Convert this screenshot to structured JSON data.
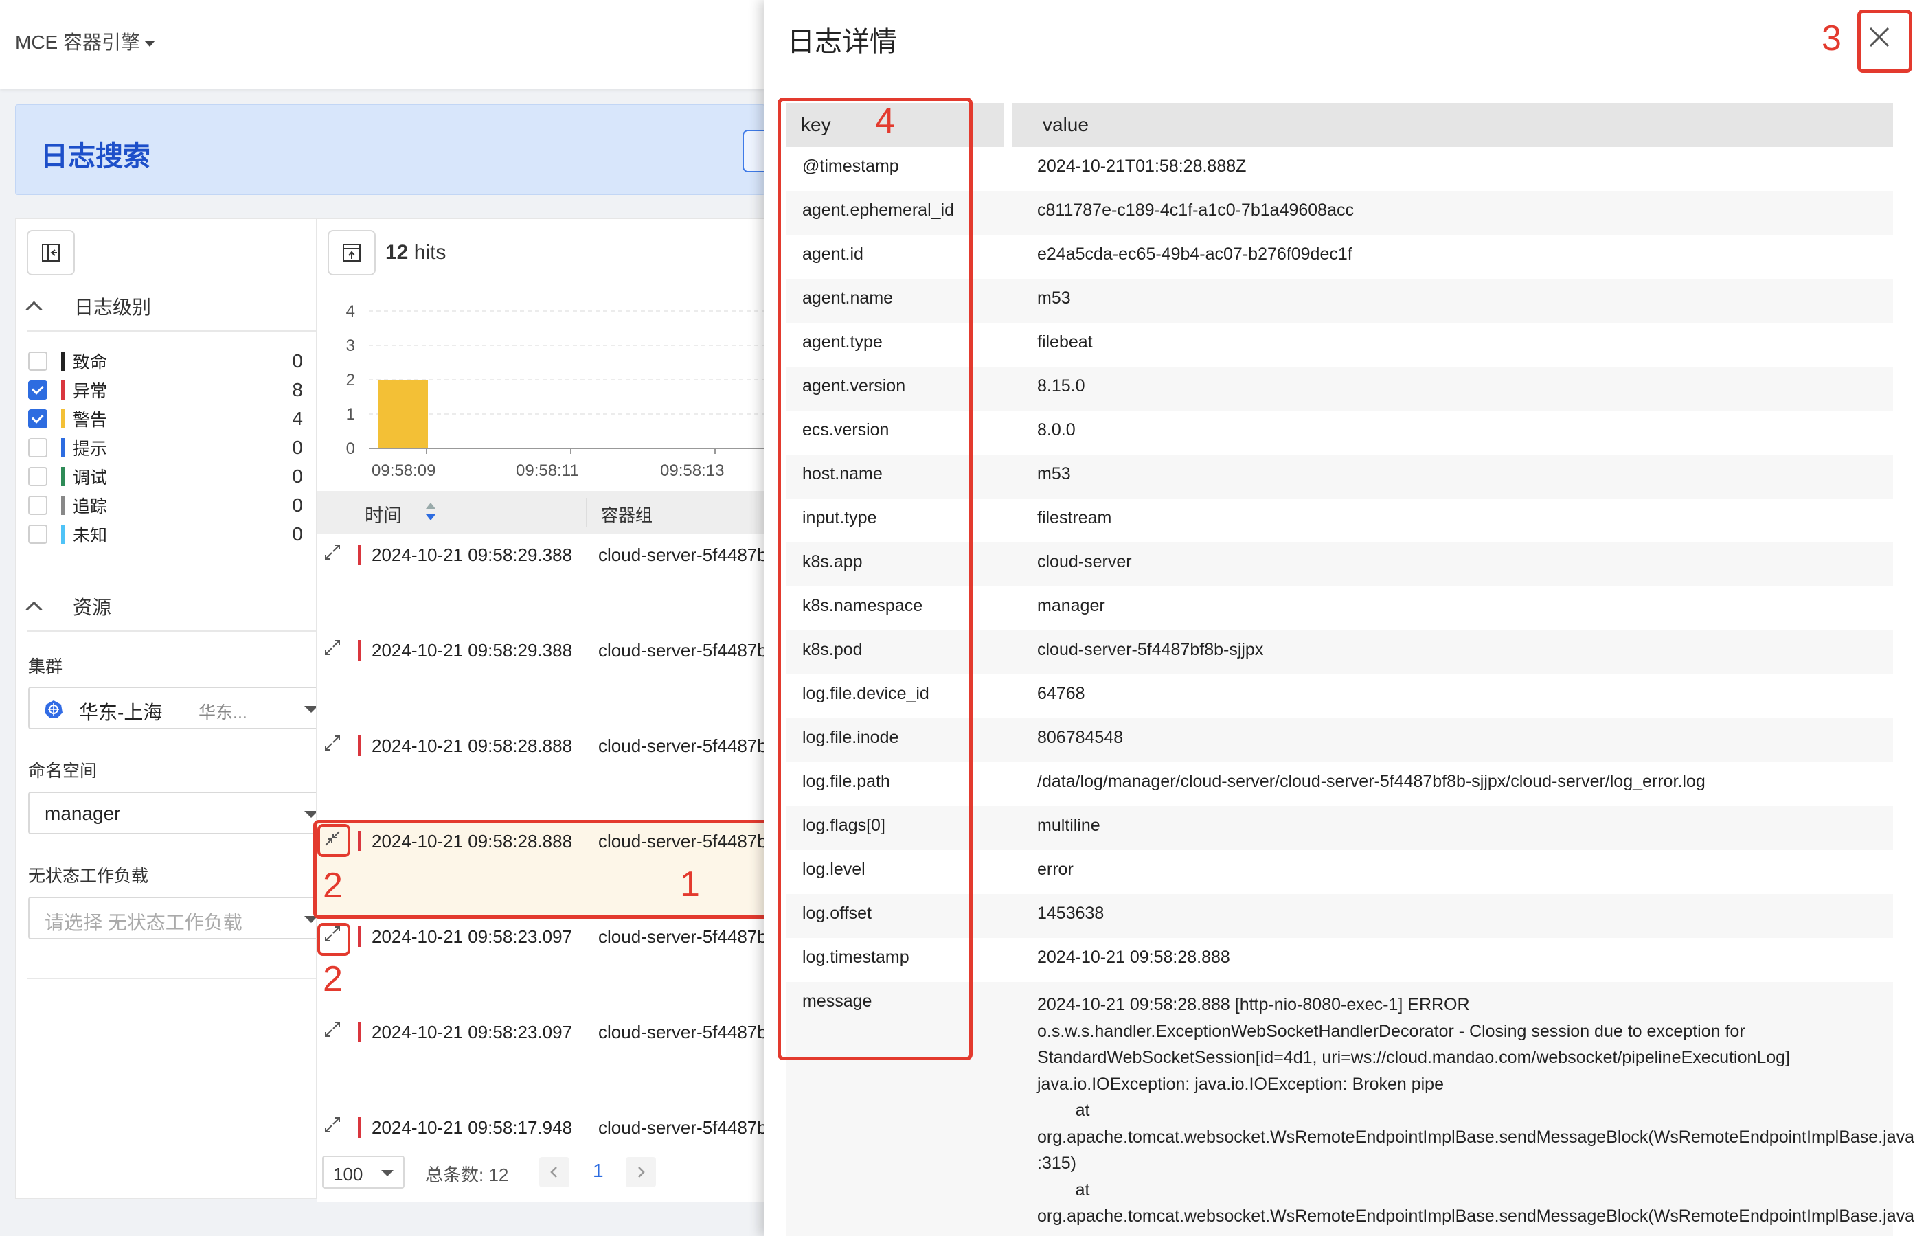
{
  "topbar": {
    "product": "MCE 容器引擎"
  },
  "banner": {
    "title": "日志搜索"
  },
  "filter": {
    "level_section": "日志级别",
    "levels": [
      {
        "label": "致命",
        "count": "0",
        "checked": false,
        "color": "#222222"
      },
      {
        "label": "异常",
        "count": "8",
        "checked": true,
        "color": "#d9363e"
      },
      {
        "label": "警告",
        "count": "4",
        "checked": true,
        "color": "#f3c036"
      },
      {
        "label": "提示",
        "count": "0",
        "checked": false,
        "color": "#2d6ce0"
      },
      {
        "label": "调试",
        "count": "0",
        "checked": false,
        "color": "#2e8b57"
      },
      {
        "label": "追踪",
        "count": "0",
        "checked": false,
        "color": "#888888"
      },
      {
        "label": "未知",
        "count": "0",
        "checked": false,
        "color": "#4fc3f7"
      }
    ],
    "resource_section": "资源",
    "cluster_label": "集群",
    "cluster_value": "华东-上海",
    "cluster_sub": "华东...",
    "namespace_label": "命名空间",
    "namespace_value": "manager",
    "workload_label": "无状态工作负载",
    "workload_placeholder": "请选择 无状态工作负载"
  },
  "main": {
    "hits_count": "12",
    "hits_label": "hits",
    "columns": [
      "时间",
      "容器组"
    ],
    "rows": [
      {
        "time": "2024-10-21 09:58:29.388",
        "group": "cloud-server-5f4487b",
        "active": false
      },
      {
        "time": "2024-10-21 09:58:29.388",
        "group": "cloud-server-5f4487b",
        "active": false
      },
      {
        "time": "2024-10-21 09:58:28.888",
        "group": "cloud-server-5f4487b",
        "active": false
      },
      {
        "time": "2024-10-21 09:58:28.888",
        "group": "cloud-server-5f4487b",
        "active": true
      },
      {
        "time": "2024-10-21 09:58:23.097",
        "group": "cloud-server-5f4487b",
        "active": false
      },
      {
        "time": "2024-10-21 09:58:23.097",
        "group": "cloud-server-5f4487b",
        "active": false
      },
      {
        "time": "2024-10-21 09:58:17.948",
        "group": "cloud-server-5f4487b",
        "active": false
      }
    ],
    "pagination": {
      "page_size": "100",
      "total_label": "总条数: 12",
      "current_page": "1"
    }
  },
  "chart_data": {
    "type": "bar",
    "categories": [
      "09:58:09",
      "09:58:11",
      "09:58:13"
    ],
    "values": [
      2,
      0,
      0
    ],
    "yticks": [
      "0",
      "1",
      "2",
      "3",
      "4"
    ],
    "ylim": [
      0,
      4
    ],
    "color": "#f3c036",
    "grid": true
  },
  "drawer": {
    "title": "日志详情",
    "columns": {
      "key": "key",
      "value": "value"
    },
    "rows": [
      {
        "key": "@timestamp",
        "value": "2024-10-21T01:58:28.888Z"
      },
      {
        "key": "agent.ephemeral_id",
        "value": "c811787e-c189-4c1f-a1c0-7b1a49608acc"
      },
      {
        "key": "agent.id",
        "value": "e24a5cda-ec65-49b4-ac07-b276f09dec1f"
      },
      {
        "key": "agent.name",
        "value": "m53"
      },
      {
        "key": "agent.type",
        "value": "filebeat"
      },
      {
        "key": "agent.version",
        "value": "8.15.0"
      },
      {
        "key": "ecs.version",
        "value": "8.0.0"
      },
      {
        "key": "host.name",
        "value": "m53"
      },
      {
        "key": "input.type",
        "value": "filestream"
      },
      {
        "key": "k8s.app",
        "value": "cloud-server"
      },
      {
        "key": "k8s.namespace",
        "value": "manager"
      },
      {
        "key": "k8s.pod",
        "value": "cloud-server-5f4487bf8b-sjjpx"
      },
      {
        "key": "log.file.device_id",
        "value": "64768"
      },
      {
        "key": "log.file.inode",
        "value": "806784548"
      },
      {
        "key": "log.file.path",
        "value": "/data/log/manager/cloud-server/cloud-server-5f4487bf8b-sjjpx/cloud-server/log_error.log"
      },
      {
        "key": "log.flags[0]",
        "value": "multiline"
      },
      {
        "key": "log.level",
        "value": "error"
      },
      {
        "key": "log.offset",
        "value": "1453638"
      },
      {
        "key": "log.timestamp",
        "value": "2024-10-21 09:58:28.888"
      }
    ],
    "message_key": "message",
    "message_value": "2024-10-21 09:58:28.888 [http-nio-8080-exec-1] ERROR\no.s.w.s.handler.ExceptionWebSocketHandlerDecorator - Closing session due to exception for\nStandardWebSocketSession[id=4d1, uri=ws://cloud.mandao.com/websocket/pipelineExecutionLog]\njava.io.IOException: java.io.IOException: Broken pipe\n        at\norg.apache.tomcat.websocket.WsRemoteEndpointImplBase.sendMessageBlock(WsRemoteEndpointImplBase.java\n:315)\n        at\norg.apache.tomcat.websocket.WsRemoteEndpointImplBase.sendMessageBlock(WsRemoteEndpointImplBase.java"
  },
  "annotations": {
    "a1": "1",
    "a2": "2",
    "a3": "3",
    "a4": "4"
  }
}
